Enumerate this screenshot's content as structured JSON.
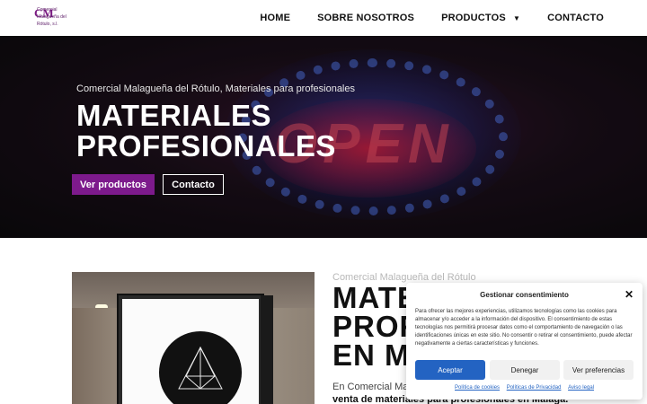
{
  "header": {
    "logo": {
      "mark": "CM",
      "line1": "Comercial",
      "line2": "Malagueña del",
      "line3": "Rótulo, s.l."
    },
    "nav": [
      {
        "label": "HOME"
      },
      {
        "label": "SOBRE NOSOTROS"
      },
      {
        "label": "PRODUCTOS",
        "dropdown": true
      },
      {
        "label": "CONTACTO"
      }
    ]
  },
  "hero": {
    "sign_text": "OPEN",
    "subtitle": "Comercial Malagueña del Rótulo, Materiales para profesionales",
    "title_line1": "MATERIALES",
    "title_line2": "PROFESIONALES",
    "primary_button": "Ver productos",
    "secondary_button": "Contacto"
  },
  "section": {
    "subtitle": "Comercial Malagueña del Rótulo",
    "title_line1": "MATERIALES",
    "title_line2": "PROFESIONALES",
    "title_line3": "EN MÁLAGA",
    "text_plain": "En Comercial Malagueña del Rótulo nos dedicamos a la",
    "text_bold": "venta de materiales para profesionales en Málaga."
  },
  "consent": {
    "title": "Gestionar consentimiento",
    "body": "Para ofrecer las mejores experiencias, utilizamos tecnologías como las cookies para almacenar y/o acceder a la información del dispositivo. El consentimiento de estas tecnologías nos permitirá procesar datos como el comportamiento de navegación o las identificaciones únicas en este sitio. No consentir o retirar el consentimiento, puede afectar negativamente a ciertas características y funciones.",
    "accept": "Aceptar",
    "deny": "Denegar",
    "preferences": "Ver preferencias",
    "links": [
      "Política de cookies",
      "Políticas de Privacidad",
      "Aviso legal"
    ]
  },
  "colors": {
    "brand_purple": "#7d1a8c",
    "accept_blue": "#2363c2"
  }
}
